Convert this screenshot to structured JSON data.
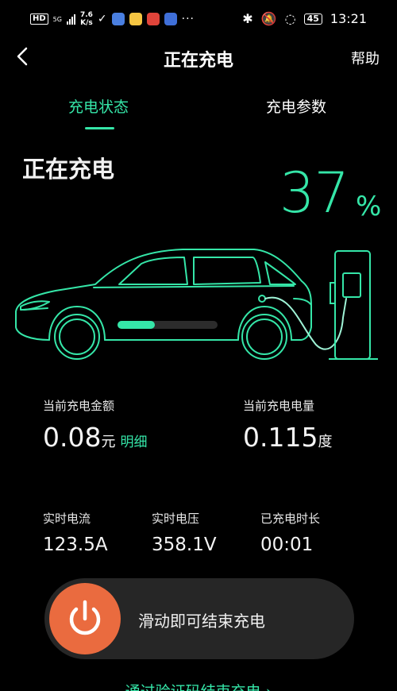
{
  "statusbar": {
    "network_type": "HD",
    "signal_label": "5G",
    "speed_value": "7.6",
    "speed_unit": "K/s",
    "more": "···",
    "battery": "45",
    "time": "13:21"
  },
  "header": {
    "title": "正在充电",
    "help_label": "帮助"
  },
  "tabs": [
    {
      "label": "充电状态",
      "active": true
    },
    {
      "label": "充电参数",
      "active": false
    }
  ],
  "charging": {
    "state_text": "正在充电",
    "percent": "37",
    "percent_sign": "%",
    "progress_fraction": 0.37
  },
  "stats": {
    "amount": {
      "label": "当前充电金额",
      "value": "0.08",
      "unit": "元",
      "detail_label": "明细"
    },
    "energy": {
      "label": "当前充电电量",
      "value": "0.115",
      "unit": "度"
    },
    "current": {
      "label": "实时电流",
      "value": "123.5A"
    },
    "voltage": {
      "label": "实时电压",
      "value": "358.1V"
    },
    "duration": {
      "label": "已充电时长",
      "value": "00:01"
    }
  },
  "slider": {
    "label": "滑动即可结束充电",
    "icon": "power-icon"
  },
  "bottom_link": "通过验证码结束充电 ›",
  "colors": {
    "accent": "#35e6a8",
    "knob": "#ea6b3f",
    "background": "#000000",
    "slider_track": "#262626"
  }
}
